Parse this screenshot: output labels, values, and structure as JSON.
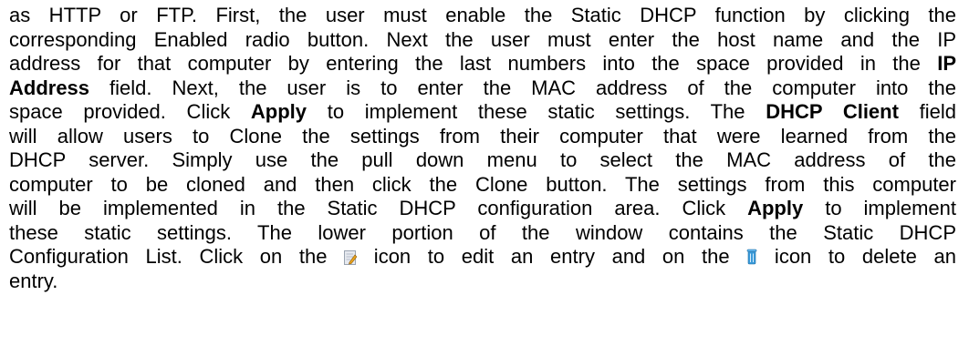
{
  "lines": [
    {
      "text": "as HTTP or FTP. First, the user must enable the Static DHCP function by clicking the"
    },
    {
      "text": "corresponding Enabled radio button. Next the user must enter the host name and the IP"
    },
    {
      "text": "address for that computer by entering the last numbers into the space provided in the ",
      "bold": "IP"
    },
    {
      "bold_lead": "Address",
      "text": " field. Next, the user is to enter the MAC address of the computer into the"
    },
    {
      "a": "space provided. Click ",
      "b1": "Apply",
      "c": " to implement these static settings. The ",
      "b2": "DHCP Client",
      "d": " field"
    },
    {
      "text": "will allow users to Clone the settings from their computer that were learned from the"
    },
    {
      "text": "DHCP server. Simply use the pull down menu to select the MAC address of the"
    },
    {
      "text": "computer to be cloned and then click the Clone button. The settings from this computer"
    },
    {
      "a": "will be implemented in the Static DHCP configuration area. Click ",
      "b": "Apply",
      "c": " to implement"
    },
    {
      "text": "these static settings. The lower portion of the window contains the Static DHCP"
    },
    {
      "text": "Configuration List. Click on the "
    },
    {
      "text": "entry."
    }
  ],
  "icon_line": {
    "before": "Configuration List. Click on the ",
    "edit_icon": "edit-icon",
    "middle": " icon to edit an entry and on the ",
    "trash_icon": "trash-icon",
    "after": " icon to delete an"
  },
  "colors": {
    "text": "#000000",
    "background": "#ffffff",
    "edit_icon_paper": "#e6e9ef",
    "edit_icon_pencil": "#e8a21c",
    "trash_icon": "#3a9ad9"
  }
}
